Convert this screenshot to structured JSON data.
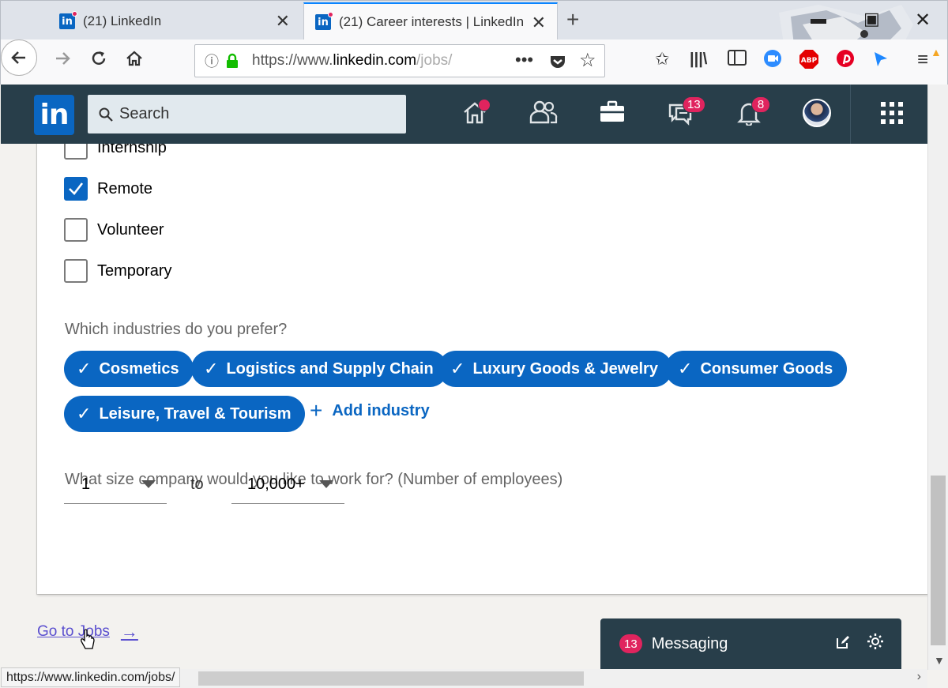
{
  "browser": {
    "tabs": [
      {
        "title": "(21) LinkedIn"
      },
      {
        "title": "(21) Career interests | LinkedIn"
      }
    ],
    "url_prefix": "https://www.",
    "url_host": "linkedin.com",
    "url_path": "/jobs/",
    "status_url": "https://www.linkedin.com/jobs/",
    "addon_labels": {
      "abp": "ABP"
    }
  },
  "header": {
    "logo_text": "in",
    "search_placeholder": "Search",
    "messaging_badge": "13",
    "notifications_badge": "8"
  },
  "job_types": [
    {
      "label": "Internship",
      "checked": false
    },
    {
      "label": "Remote",
      "checked": true
    },
    {
      "label": "Volunteer",
      "checked": false
    },
    {
      "label": "Temporary",
      "checked": false
    }
  ],
  "industries": {
    "question": "Which industries do you prefer?",
    "selected": [
      "Cosmetics",
      "Logistics and Supply Chain",
      "Luxury Goods & Jewelry",
      "Consumer Goods",
      "Leisure, Travel & Tourism"
    ],
    "add_label": "Add industry"
  },
  "company_size": {
    "question": "What size company would you like to work for? (Number of employees)",
    "min_value": "1",
    "to_label": "to",
    "max_value": "10,000+"
  },
  "footer": {
    "goto_jobs": "Go to Jobs"
  },
  "messaging": {
    "badge": "13",
    "label": "Messaging"
  },
  "colors": {
    "linkedin_blue": "#0a66c2",
    "header_bg": "#283e4a",
    "badge_red": "#e0245e"
  }
}
